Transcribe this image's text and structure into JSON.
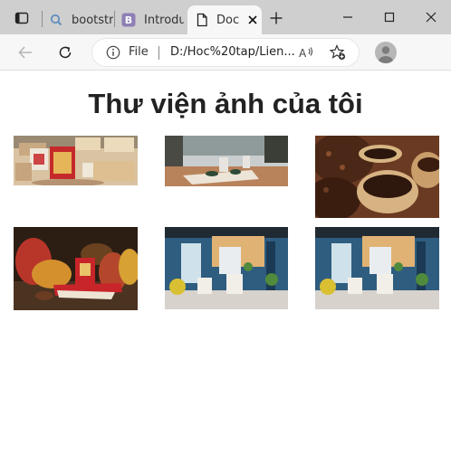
{
  "browser": {
    "tabs": [
      {
        "label": "bootstra",
        "icon": "search-icon"
      },
      {
        "label": "Introduc",
        "icon": "bootstrap-icon"
      },
      {
        "label": "Doc",
        "icon": "document-icon",
        "active": true
      }
    ],
    "new_tab_icon": "plus-icon",
    "window_controls": [
      "minimize-icon",
      "maximize-icon",
      "close-icon"
    ]
  },
  "toolbar": {
    "scheme_label": "File",
    "url": "D:/Hoc%20tap/Lien...",
    "icons": [
      "back-icon",
      "refresh-icon",
      "info-icon",
      "read-aloud-icon",
      "add-favorite-icon",
      "profile-icon"
    ]
  },
  "page": {
    "title": "Thư viện ảnh của tôi",
    "gallery": [
      {
        "subject": "chocolate-gift-boxes"
      },
      {
        "subject": "cafe-table-with-cups"
      },
      {
        "subject": "coffee-beans-in-bowls"
      },
      {
        "subject": "cocoa-pods-and-chocolate"
      },
      {
        "subject": "cafe-interior"
      },
      {
        "subject": "cafe-interior"
      }
    ]
  },
  "colors": {
    "tabbar_bg": "#cfcfcf",
    "toolbar_bg": "#f7f7f7",
    "title_text": "#222222"
  }
}
